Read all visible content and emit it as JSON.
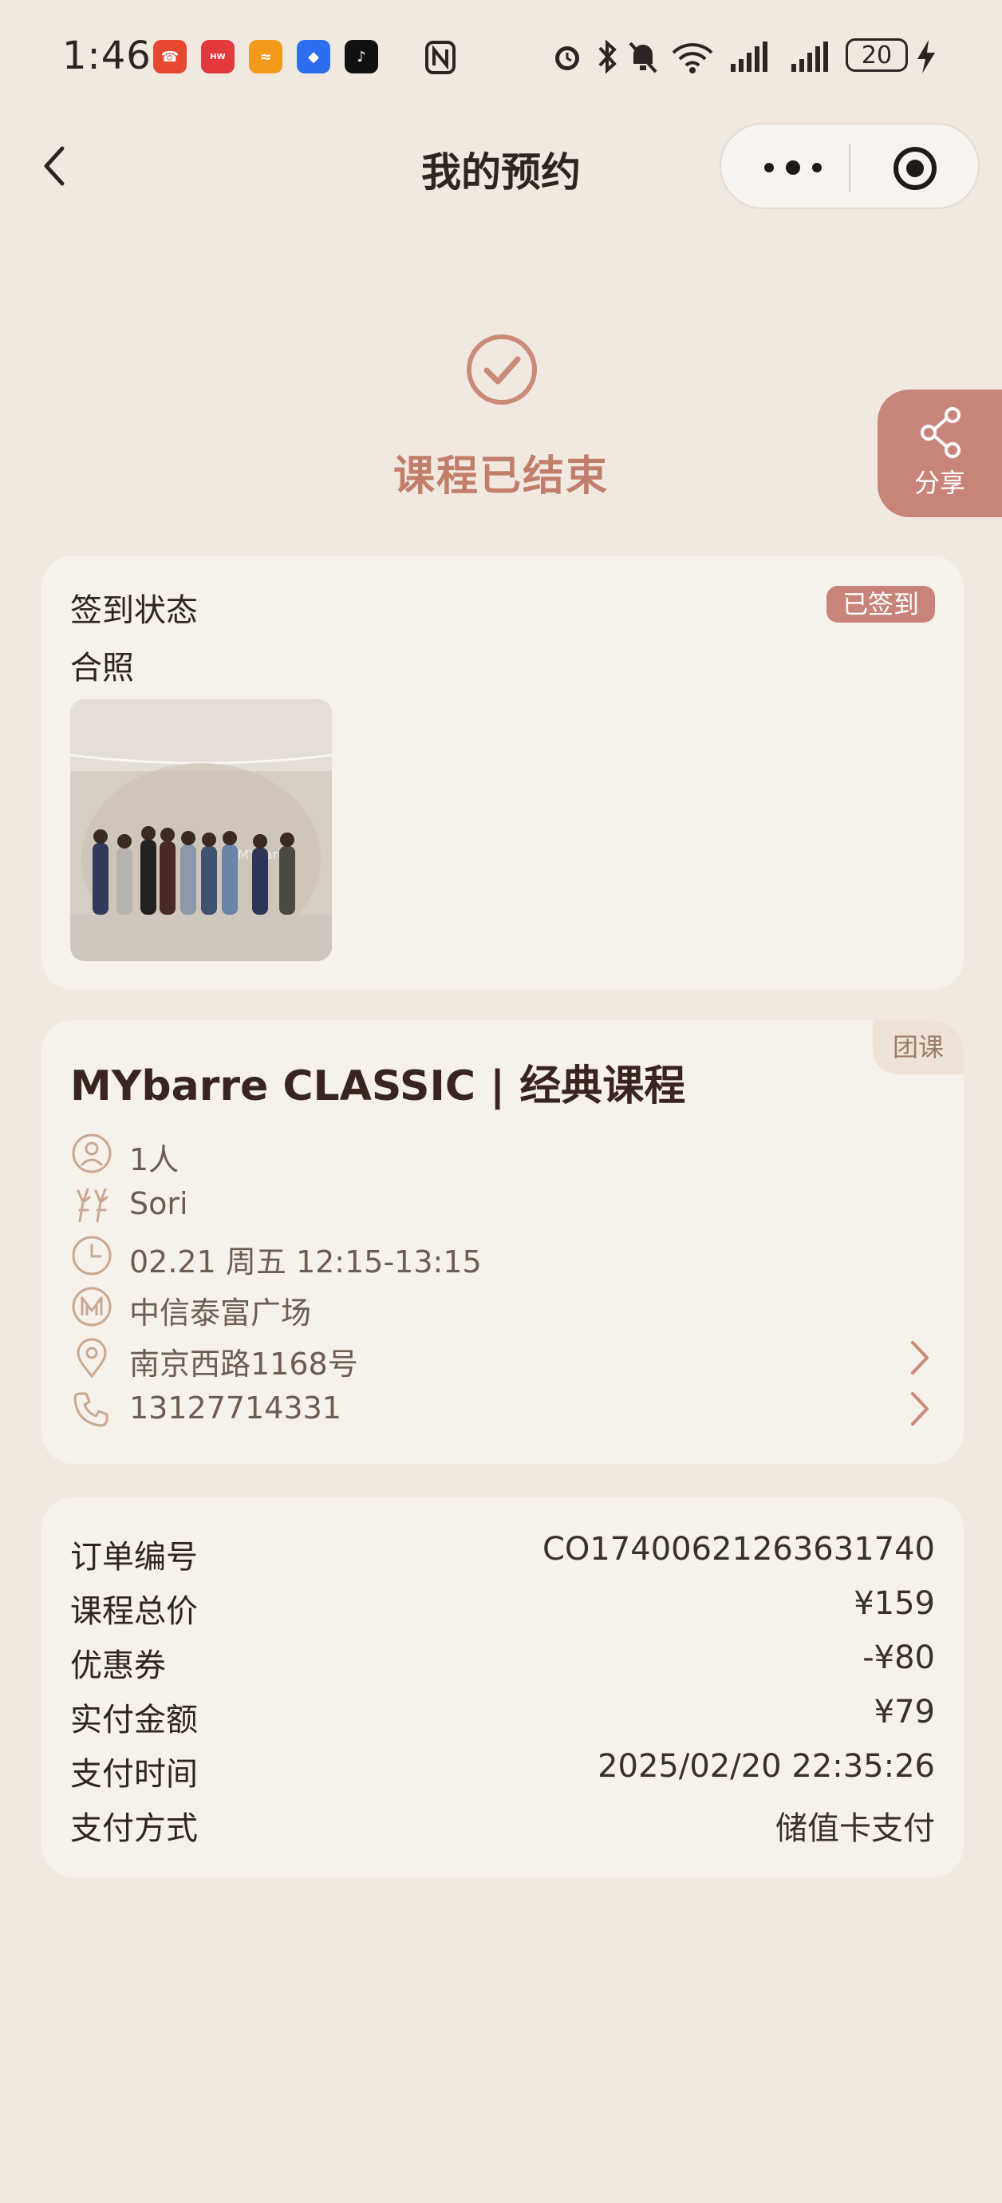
{
  "status_bar": {
    "time": "1:46",
    "battery": "20",
    "app_icons": [
      "phone-missed-icon",
      "huawei-store-icon",
      "orange-app-icon",
      "blue-app-icon",
      "tiktok-icon"
    ],
    "icons": [
      "nfc-icon",
      "alarm-icon",
      "bluetooth-icon",
      "mute-icon",
      "wifi-icon",
      "signal-icon",
      "signal-icon",
      "charging-icon"
    ]
  },
  "nav": {
    "title": "我的预约"
  },
  "hero": {
    "status_text": "课程已结束"
  },
  "share": {
    "label": "分享"
  },
  "checkin_card": {
    "title": "签到状态",
    "badge": "已签到",
    "photo_label": "合照"
  },
  "course_card": {
    "tag": "团课",
    "title": "MYbarre CLASSIC | 经典课程",
    "rows": [
      {
        "icon": "person-icon",
        "text": "1人"
      },
      {
        "icon": "dancer-icon",
        "text": "Sori"
      },
      {
        "icon": "clock-icon",
        "text": "02.21 周五 12:15-13:15"
      },
      {
        "icon": "studio-logo-icon",
        "text": "中信泰富广场"
      },
      {
        "icon": "location-pin-icon",
        "text": "南京西路1168号"
      },
      {
        "icon": "phone-icon",
        "text": "13127714331"
      }
    ]
  },
  "order_card": {
    "rows": [
      {
        "label": "订单编号",
        "value": "CO17400621263631740"
      },
      {
        "label": "课程总价",
        "value": "¥159"
      },
      {
        "label": "优惠券",
        "value": "-¥80"
      },
      {
        "label": "实付金额",
        "value": "¥79"
      },
      {
        "label": "支付时间",
        "value": "2025/02/20 22:35:26"
      },
      {
        "label": "支付方式",
        "value": "储值卡支付"
      }
    ]
  },
  "colors": {
    "accent": "#c9847a",
    "background": "#f1e9e0",
    "card": "#f6f1eb"
  }
}
